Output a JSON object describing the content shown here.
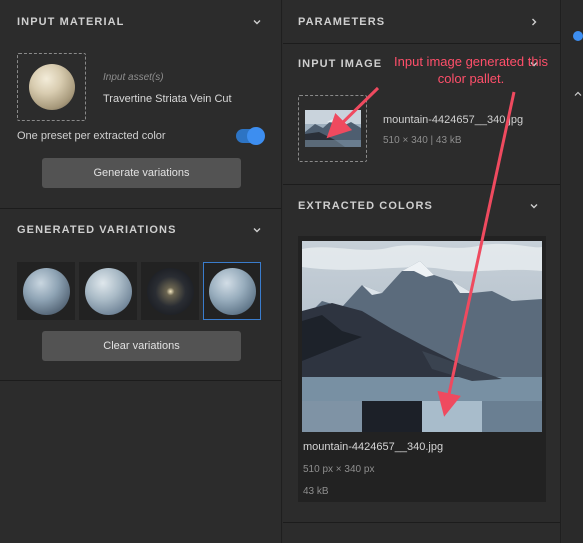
{
  "input_material": {
    "title": "INPUT MATERIAL",
    "asset_label": "Input asset(s)",
    "asset_name": "Travertine Striata Vein Cut",
    "preset_label": "One preset per extracted color",
    "preset_toggle_on": true,
    "generate_button": "Generate variations"
  },
  "generated_variations": {
    "title": "GENERATED VARIATIONS",
    "clear_button": "Clear variations",
    "selected_index": 3
  },
  "parameters": {
    "title": "PARAMETERS"
  },
  "input_image": {
    "title": "INPUT IMAGE",
    "filename": "mountain-4424657__340.jpg",
    "meta": "510 × 340 | 43 kB"
  },
  "extracted_colors": {
    "title": "EXTRACTED COLORS",
    "swatches": [
      "#7f93a5",
      "#1c2028",
      "#a8bccb",
      "#6a7f92"
    ],
    "filename": "mountain-4424657__340.jpg",
    "dimensions": "510 px × 340 px",
    "size": "43 kB"
  },
  "annotation": {
    "line1": "Input image generated this",
    "line2": "color pallet.",
    "color": "#ff4f6a"
  }
}
